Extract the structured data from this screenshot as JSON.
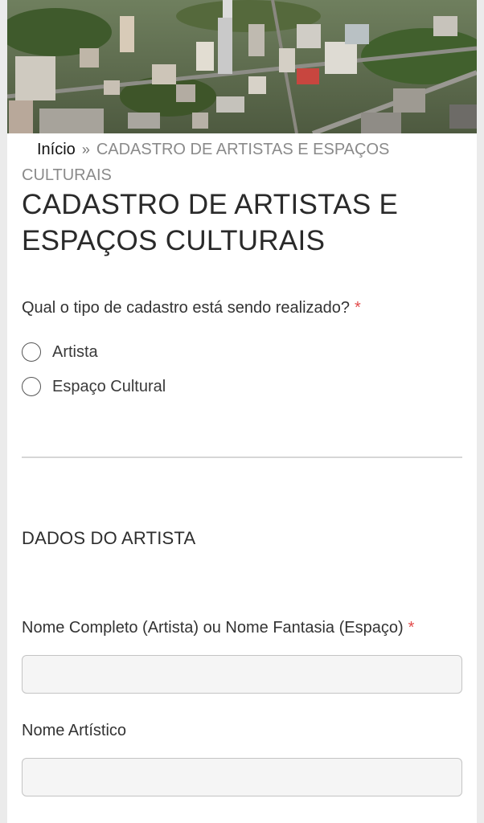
{
  "breadcrumb": {
    "home": "Início",
    "separator": "»",
    "current": "CADASTRO DE ARTISTAS E ESPAÇOS CULTURAIS"
  },
  "page": {
    "title": "CADASTRO DE ARTISTAS E ESPAÇOS CULTURAIS"
  },
  "form": {
    "required_marker": "*",
    "question": {
      "label": "Qual o tipo de cadastro está sendo realizado?",
      "options": [
        {
          "label": "Artista",
          "selected": false
        },
        {
          "label": "Espaço Cultural",
          "selected": false
        }
      ]
    },
    "section_title": "DADOS DO ARTISTA",
    "fields": [
      {
        "label": "Nome Completo (Artista) ou Nome Fantasia (Espaço)",
        "required": true,
        "value": ""
      },
      {
        "label": "Nome Artístico",
        "required": false,
        "value": ""
      }
    ]
  },
  "colors": {
    "required": "#e24b4b",
    "input_bg": "#f5f5f5",
    "input_border": "#c4c4c4",
    "divider": "#d6d6d6"
  }
}
